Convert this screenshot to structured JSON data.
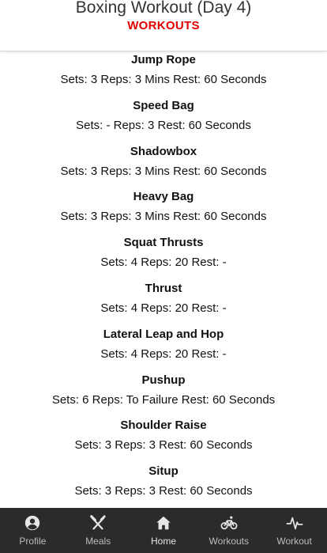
{
  "header": {
    "title": "Boxing Workout (Day 4)",
    "subtitle": "WORKOUTS"
  },
  "exercises": [
    {
      "name": "Jump Rope",
      "details": "Sets: 3 Reps: 3 Mins Rest: 60 Seconds"
    },
    {
      "name": "Speed Bag",
      "details": "Sets: - Reps: 3 Rest: 60 Seconds"
    },
    {
      "name": "Shadowbox",
      "details": "Sets: 3 Reps: 3 Mins Rest: 60 Seconds"
    },
    {
      "name": "Heavy Bag",
      "details": "Sets: 3 Reps: 3 Mins Rest: 60 Seconds"
    },
    {
      "name": "Squat Thrusts",
      "details": "Sets: 4 Reps: 20 Rest: -"
    },
    {
      "name": "Thrust",
      "details": "Sets: 4 Reps: 20 Rest: -"
    },
    {
      "name": "Lateral Leap and Hop",
      "details": "Sets: 4 Reps: 20 Rest: -"
    },
    {
      "name": "Pushup",
      "details": "Sets: 6 Reps: To Failure Rest: 60 Seconds"
    },
    {
      "name": "Shoulder Raise",
      "details": "Sets: 3 Reps: 3 Rest: 60 Seconds"
    },
    {
      "name": "Situp",
      "details": "Sets: 3 Reps: 3 Rest: 60 Seconds"
    }
  ],
  "nav": {
    "items": [
      {
        "label": "Profile",
        "icon": "profile-icon"
      },
      {
        "label": "Meals",
        "icon": "meals-icon"
      },
      {
        "label": "Home",
        "icon": "home-icon"
      },
      {
        "label": "Workouts",
        "icon": "bicycle-icon"
      },
      {
        "label": "Workout",
        "icon": "heartbeat-icon"
      }
    ]
  },
  "colors": {
    "accent": "#e00000",
    "nav_background": "#2b2b2b",
    "nav_icon": "#e6e6e6"
  }
}
